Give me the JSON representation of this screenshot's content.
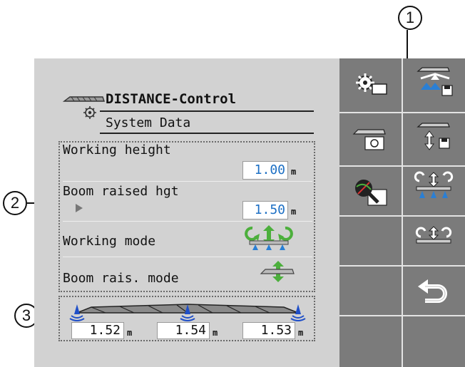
{
  "header": {
    "title": "DISTANCE-Control",
    "subtitle": "System Data"
  },
  "rows": [
    {
      "label": "Working height",
      "value": "1.00",
      "unit": "m"
    },
    {
      "label": "Boom raised hgt",
      "value": "1.50",
      "unit": "m"
    },
    {
      "label": "Working mode",
      "icon": "boom-working-mode-icon"
    },
    {
      "label": "Boom rais. mode",
      "icon": "boom-raise-mode-icon"
    }
  ],
  "boom_heights": [
    {
      "value": "1.52",
      "unit": "m"
    },
    {
      "value": "1.54",
      "unit": "m"
    },
    {
      "value": "1.53",
      "unit": "m"
    }
  ],
  "side_buttons": [
    {
      "name": "settings-icon"
    },
    {
      "name": "save-boom-profile-icon"
    },
    {
      "name": "boom-settings-icon"
    },
    {
      "name": "save-boom-height-icon"
    },
    {
      "name": "sensor-diagnostics-icon"
    },
    {
      "name": "boom-tilt-nozzles-icon"
    },
    {
      "name": "boom-tilt-icon"
    },
    {
      "name": "back-icon"
    }
  ],
  "callouts": [
    "1",
    "2",
    "3"
  ],
  "colors": {
    "screen_bg": "#d2d2d2",
    "side_panel": "#7b7b7b",
    "value_text": "#1c6fc4",
    "icon_green": "#4caf3c",
    "icon_blue": "#2a7fd4"
  }
}
